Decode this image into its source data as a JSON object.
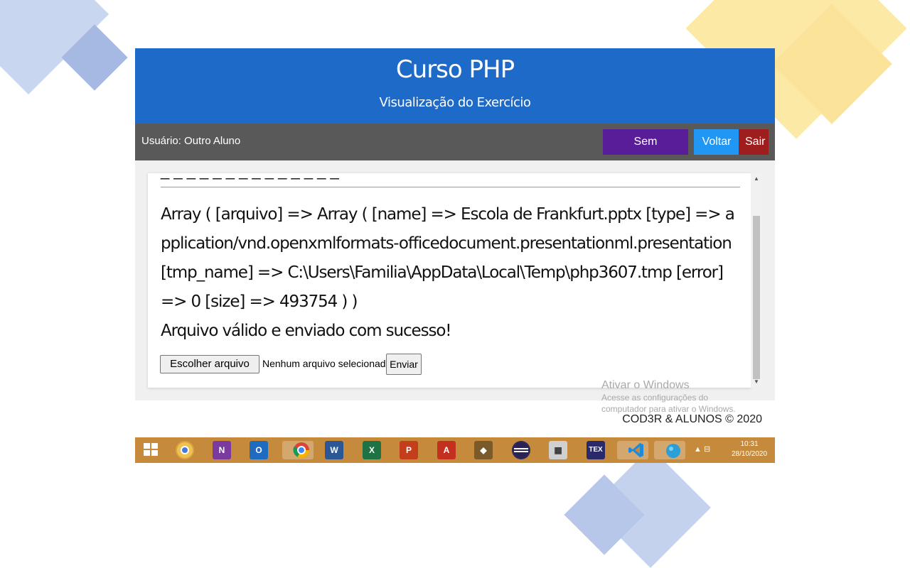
{
  "header": {
    "title": "Curso PHP",
    "subtitle": "Visualização do Exercício"
  },
  "navbar": {
    "user": "Usuário: Outro Aluno",
    "buttons": {
      "plain": "Sem formatação",
      "back": "Voltar",
      "exit": "Sair"
    }
  },
  "content": {
    "output": "Array ( [arquivo] => Array ( [name] => Escola de Frankfurt.pptx [type] => application/vnd.openxmlformats-officedocument.presentationml.presentation [tmp_name] => C:\\Users\\Familia\\AppData\\Local\\Temp\\php3607.tmp [error] => 0 [size] => 493754 ) )",
    "message": "Arquivo válido e enviado com sucesso!",
    "file_button": "Escolher arquivo",
    "file_status": "Nenhum arquivo selecionado",
    "submit": "Enviar"
  },
  "footer": {
    "copyright": "COD3R & ALUNOS © 2020"
  },
  "watermark": {
    "title": "Ativar o Windows",
    "line1": "Acesse as configurações do",
    "line2": "computador para ativar o Windows."
  },
  "taskbar": {
    "time": "10:31",
    "date": "28/10/2020",
    "icons": [
      "windows-start",
      "chrome-canary",
      "onenote",
      "outlook",
      "chrome",
      "word",
      "excel",
      "powerpoint",
      "acrobat",
      "game",
      "eclipse",
      "calculator",
      "tex",
      "vscode",
      "mongodb"
    ]
  },
  "colors": {
    "header": "#1e6ac8",
    "navbar": "#595959",
    "plain_button": "#5a1d99",
    "back_button": "#2196f3",
    "exit_button": "#9f1d1d",
    "taskbar": "#c58a3c"
  }
}
